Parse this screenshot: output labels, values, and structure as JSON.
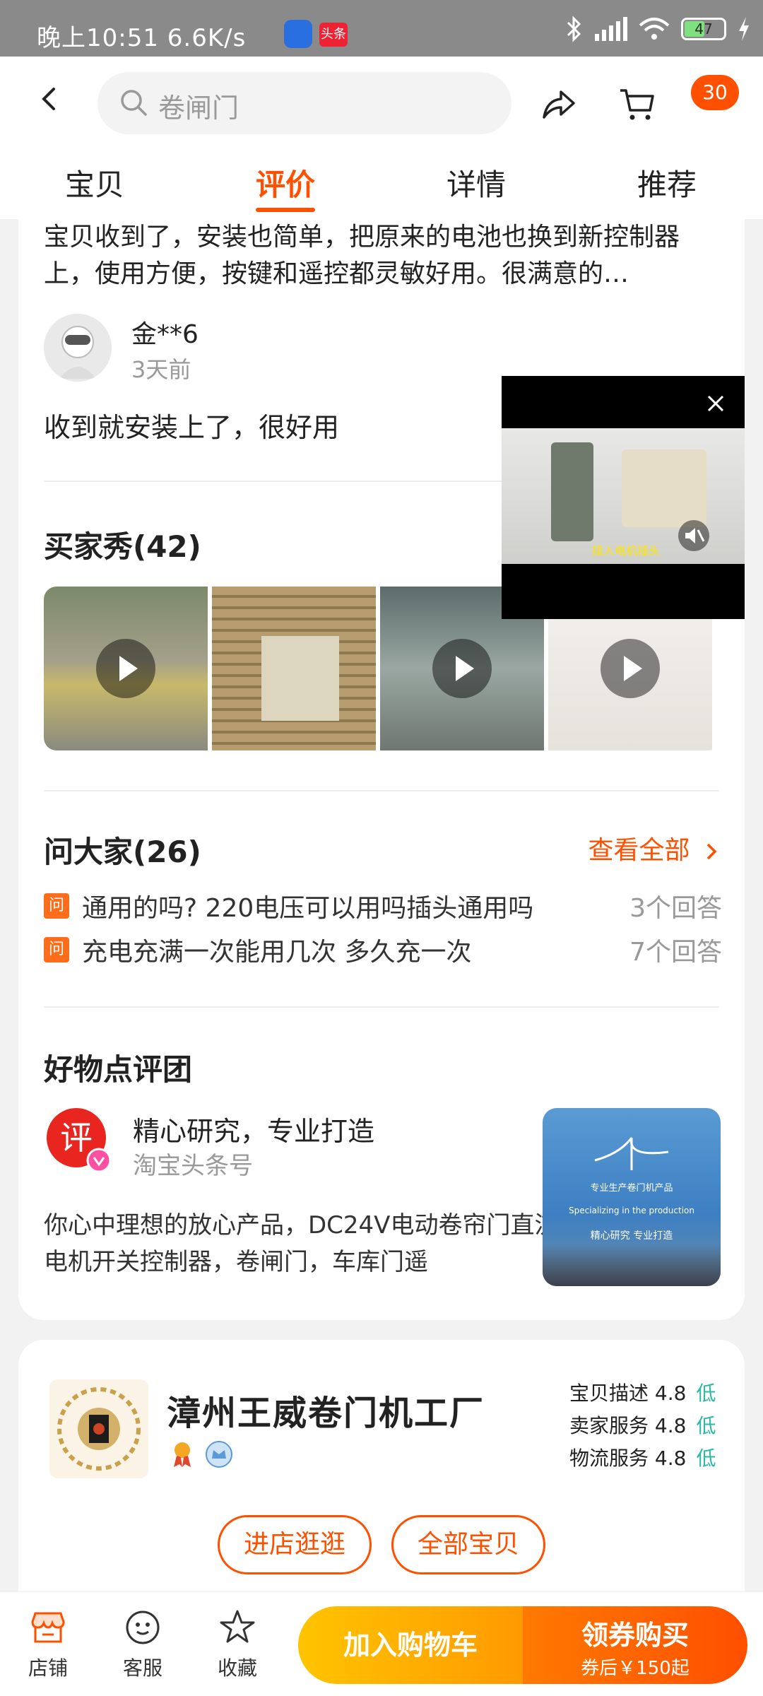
{
  "status_bar": {
    "time": "晚上10:51",
    "speed": "6.6K/s",
    "battery": "47"
  },
  "header": {
    "search_placeholder": "卷闸门",
    "cart_badge": "30"
  },
  "tabs": [
    {
      "label": "宝贝"
    },
    {
      "label": "评价",
      "active": true
    },
    {
      "label": "详情"
    },
    {
      "label": "推荐"
    }
  ],
  "review1": {
    "text": "宝贝收到了，安装也简单，把原来的电池也换到新控制器上，使用方便，按键和遥控都灵敏好用。很满意的…"
  },
  "review2": {
    "user": "金**6",
    "date": "3天前",
    "text": "收到就安装上了，很好用"
  },
  "buyer_show": {
    "title": "买家秀(42)"
  },
  "questions": {
    "title": "问大家(26)",
    "see_all": "查看全部",
    "items": [
      {
        "icon": "问",
        "question": "通用的吗? 220电压可以用吗插头通用吗",
        "answers": "3个回答"
      },
      {
        "icon": "问",
        "question": "充电充满一次能用几次 多久充一次",
        "answers": "7个回答"
      }
    ]
  },
  "review_team": {
    "title": "好物点评团",
    "logo_char": "评",
    "headline": "精心研究，专业打造",
    "source": "淘宝头条号",
    "desc": "你心中理想的放心产品，DC24V电动卷帘门直流电机开关控制器，卷闸门，车库门遥",
    "image_text_1": "专业生产卷门机产品",
    "image_text_2": "Specializing in the production",
    "image_text_3": "精心研究  专业打造"
  },
  "shop": {
    "name": "漳州王威卷门机工厂",
    "ratings": [
      {
        "label": "宝贝描述",
        "score": "4.8",
        "level": "低"
      },
      {
        "label": "卖家服务",
        "score": "4.8",
        "level": "低"
      },
      {
        "label": "物流服务",
        "score": "4.8",
        "level": "低"
      }
    ],
    "enter_store": "进店逛逛",
    "all_items": "全部宝贝"
  },
  "video": {
    "subtitle": "接入电机插头"
  },
  "bottom_bar": {
    "store": "店铺",
    "service": "客服",
    "favorite": "收藏",
    "add_to_cart": "加入购物车",
    "buy_label": "领券购买",
    "buy_price": "券后￥150起"
  },
  "colors": {
    "accent": "#ff5000",
    "good_rating": "#2cb9a3"
  }
}
